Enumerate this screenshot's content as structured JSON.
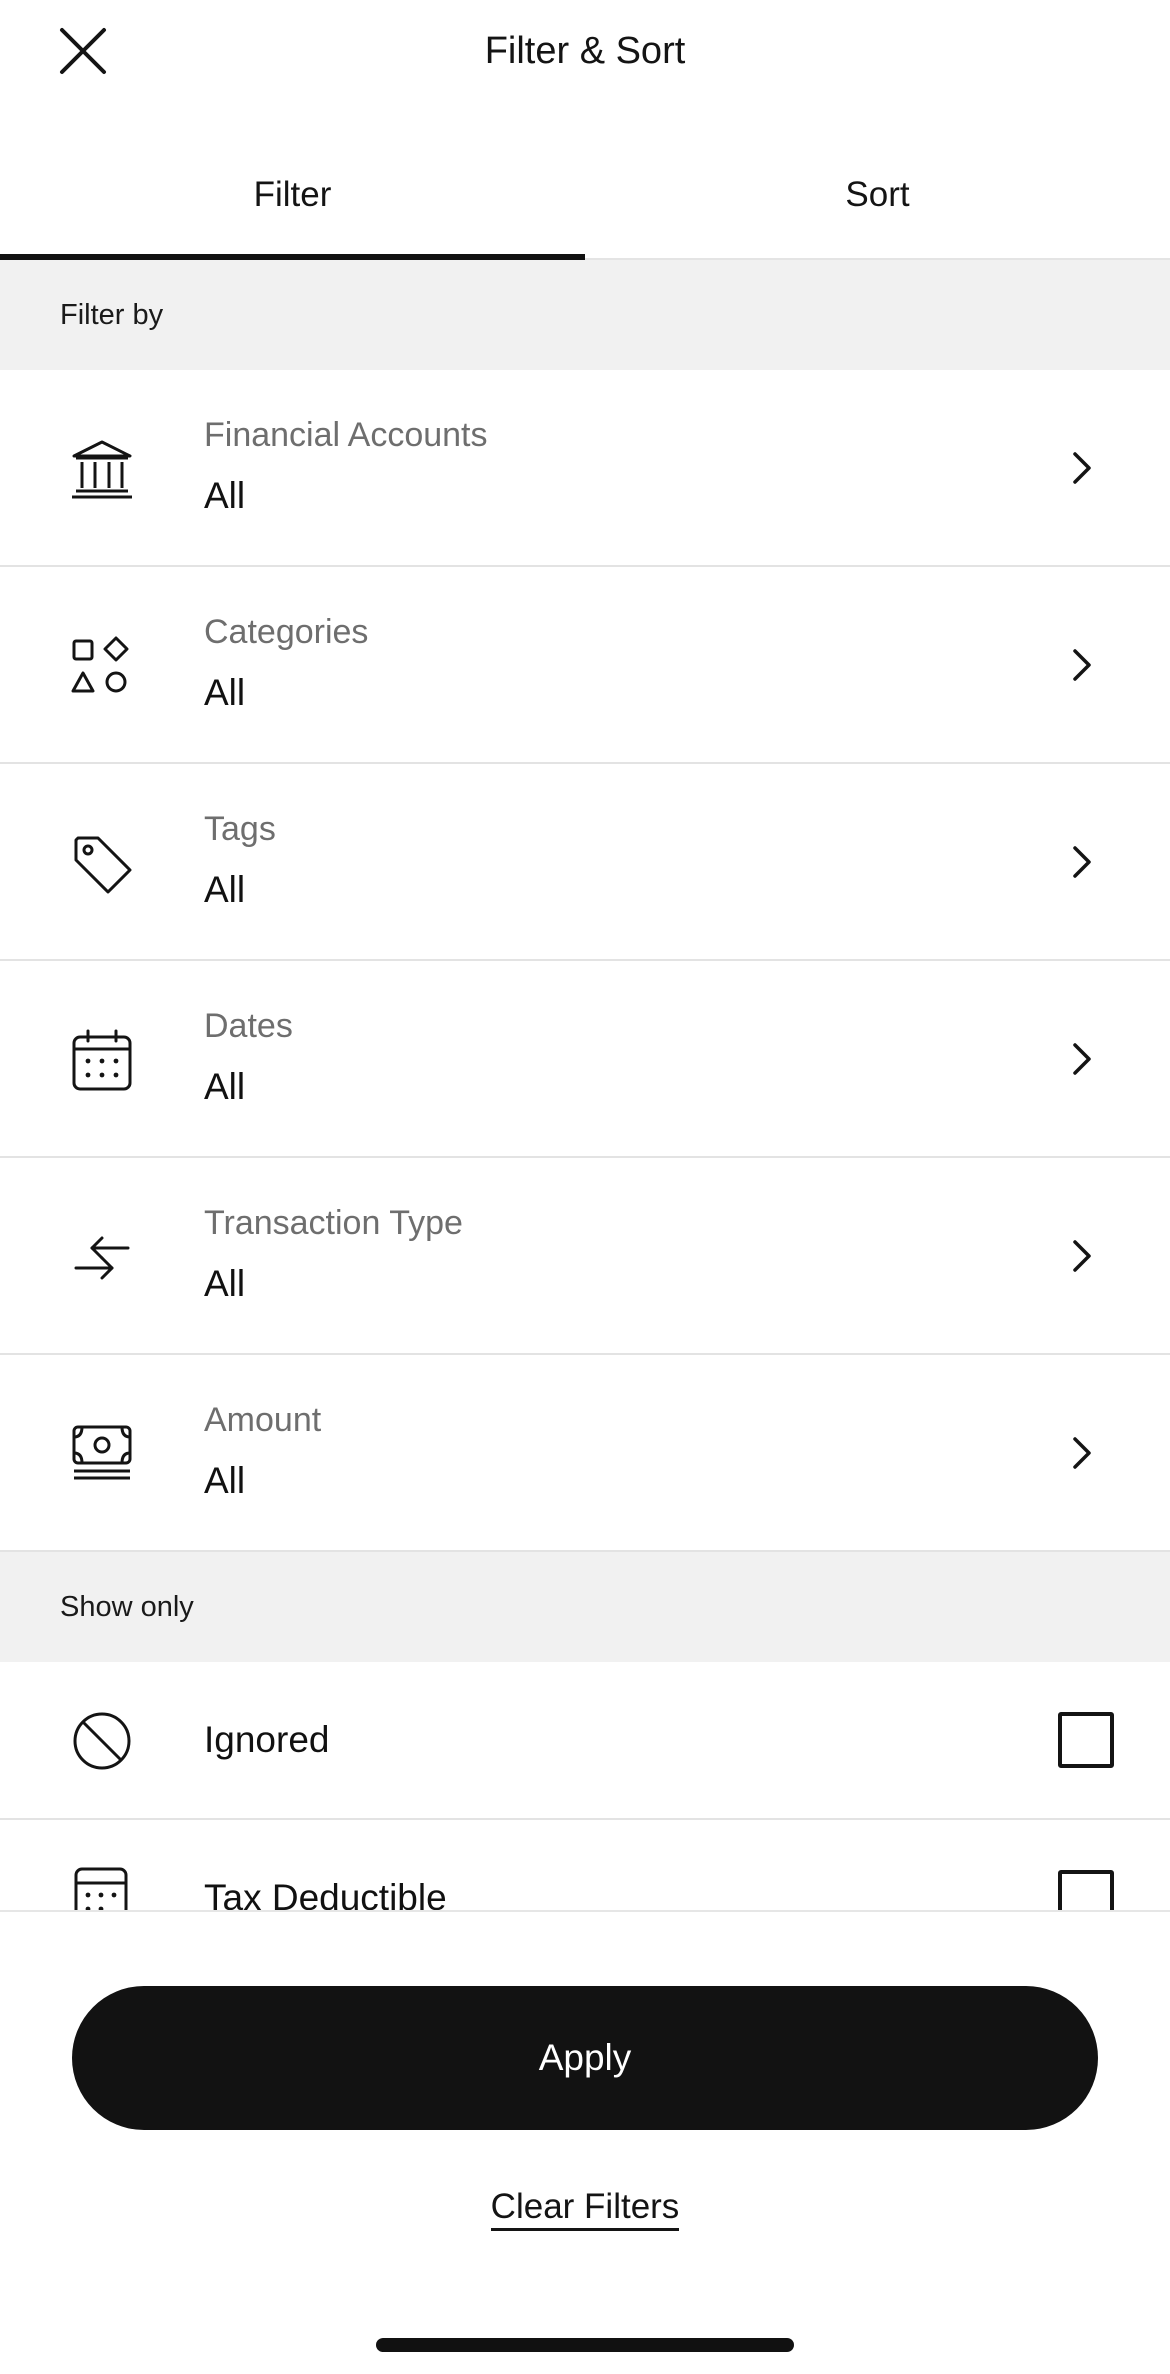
{
  "header": {
    "title": "Filter & Sort",
    "close_icon": "close-icon"
  },
  "tabs": [
    {
      "label": "Filter",
      "active": true
    },
    {
      "label": "Sort",
      "active": false
    }
  ],
  "filter_section": {
    "heading": "Filter by",
    "items": [
      {
        "label": "Financial Accounts",
        "value": "All",
        "icon": "bank-icon"
      },
      {
        "label": "Categories",
        "value": "All",
        "icon": "shapes-icon"
      },
      {
        "label": "Tags",
        "value": "All",
        "icon": "tag-icon"
      },
      {
        "label": "Dates",
        "value": "All",
        "icon": "calendar-icon"
      },
      {
        "label": "Transaction Type",
        "value": "All",
        "icon": "arrows-exchange-icon"
      },
      {
        "label": "Amount",
        "value": "All",
        "icon": "cash-icon"
      }
    ]
  },
  "show_only_section": {
    "heading": "Show only",
    "items": [
      {
        "label": "Ignored",
        "checked": false,
        "icon": "prohibited-icon"
      },
      {
        "label": "Tax Deductible",
        "checked": false,
        "icon": "calculator-icon"
      }
    ]
  },
  "footer": {
    "apply_label": "Apply",
    "clear_label": "Clear Filters"
  },
  "colors": {
    "primary": "#121212",
    "section_background": "#f1f1f1",
    "secondary_text": "#6e6e6e"
  }
}
